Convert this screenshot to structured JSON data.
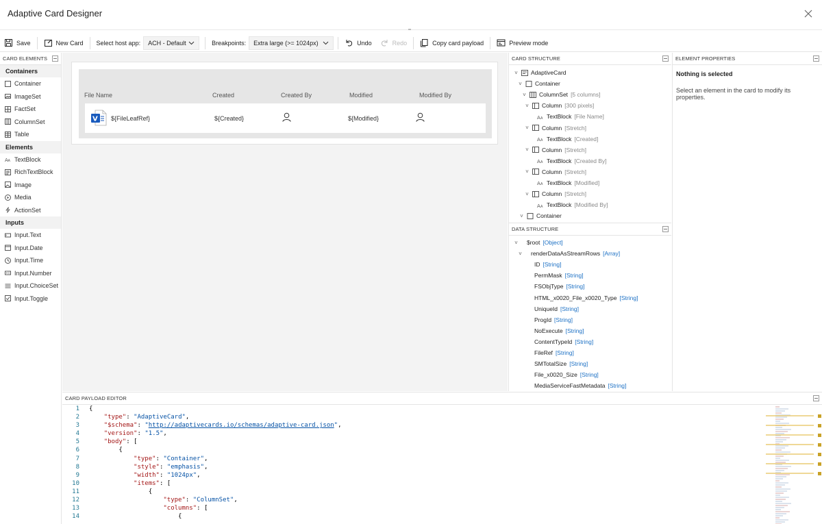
{
  "window": {
    "title": "Adaptive Card Designer"
  },
  "toolbar": {
    "save": "Save",
    "new_card": "New Card",
    "host_label": "Select host app:",
    "host_value": "ACH - Default",
    "bp_label": "Breakpoints:",
    "bp_value": "Extra large (>= 1024px)",
    "undo": "Undo",
    "redo": "Redo",
    "copy": "Copy card payload",
    "preview": "Preview mode"
  },
  "left": {
    "header": "CARD ELEMENTS",
    "containers_label": "Containers",
    "containers": [
      "Container",
      "ImageSet",
      "FactSet",
      "ColumnSet",
      "Table"
    ],
    "elements_label": "Elements",
    "elements": [
      "TextBlock",
      "RichTextBlock",
      "Image",
      "Media",
      "ActionSet"
    ],
    "inputs_label": "Inputs",
    "inputs": [
      "Input.Text",
      "Input.Date",
      "Input.Time",
      "Input.Number",
      "Input.ChoiceSet",
      "Input.Toggle"
    ]
  },
  "card": {
    "headers": [
      "File Name",
      "Created",
      "Created By",
      "Modified",
      "Modified By"
    ],
    "cells": {
      "file": "${FileLeafRef}",
      "created": "${Created}",
      "modified": "${Modified}"
    }
  },
  "structure": {
    "header": "CARD STRUCTURE",
    "rows": [
      {
        "label": "AdaptiveCard",
        "sub": ""
      },
      {
        "label": "Container",
        "sub": ""
      },
      {
        "label": "ColumnSet",
        "sub": "[5 columns]"
      },
      {
        "label": "Column",
        "sub": "[300 pixels]"
      },
      {
        "label": "TextBlock",
        "sub": "[File Name]"
      },
      {
        "label": "Column",
        "sub": "[Stretch]"
      },
      {
        "label": "TextBlock",
        "sub": "[Created]"
      },
      {
        "label": "Column",
        "sub": "[Stretch]"
      },
      {
        "label": "TextBlock",
        "sub": "[Created By]"
      },
      {
        "label": "Column",
        "sub": "[Stretch]"
      },
      {
        "label": "TextBlock",
        "sub": "[Modified]"
      },
      {
        "label": "Column",
        "sub": "[Stretch]"
      },
      {
        "label": "TextBlock",
        "sub": "[Modified By]"
      },
      {
        "label": "Container",
        "sub": ""
      }
    ]
  },
  "data_structure": {
    "header": "DATA STRUCTURE",
    "rows": [
      {
        "label": "$root",
        "type": "[Object]"
      },
      {
        "label": "renderDataAsStreamRows",
        "type": "[Array]"
      },
      {
        "label": "ID",
        "type": "[String]"
      },
      {
        "label": "PermMask",
        "type": "[String]"
      },
      {
        "label": "FSObjType",
        "type": "[String]"
      },
      {
        "label": "HTML_x0020_File_x0020_Type",
        "type": "[String]"
      },
      {
        "label": "UniqueId",
        "type": "[String]"
      },
      {
        "label": "ProgId",
        "type": "[String]"
      },
      {
        "label": "NoExecute",
        "type": "[String]"
      },
      {
        "label": "ContentTypeId",
        "type": "[String]"
      },
      {
        "label": "FileRef",
        "type": "[String]"
      },
      {
        "label": "SMTotalSize",
        "type": "[String]"
      },
      {
        "label": "File_x0020_Size",
        "type": "[String]"
      },
      {
        "label": "MediaServiceFastMetadata",
        "type": "[String]"
      }
    ]
  },
  "properties": {
    "header": "ELEMENT PROPERTIES",
    "none": "Nothing is selected",
    "desc": "Select an element in the card to modify its properties."
  },
  "editor": {
    "header": "CARD PAYLOAD EDITOR",
    "lines": [
      {
        "n": "1",
        "parts": [
          {
            "t": "{",
            "c": "pun"
          }
        ]
      },
      {
        "n": "2",
        "parts": [
          {
            "t": "    "
          },
          {
            "t": "\"type\"",
            "c": "key"
          },
          {
            "t": ": ",
            "c": "pun"
          },
          {
            "t": "\"AdaptiveCard\"",
            "c": "str"
          },
          {
            "t": ",",
            "c": "pun"
          }
        ]
      },
      {
        "n": "3",
        "parts": [
          {
            "t": "    "
          },
          {
            "t": "\"$schema\"",
            "c": "key"
          },
          {
            "t": ": ",
            "c": "pun"
          },
          {
            "t": "\"",
            "c": "str"
          },
          {
            "t": "http://adaptivecards.io/schemas/adaptive-card.json",
            "c": "url"
          },
          {
            "t": "\"",
            "c": "str"
          },
          {
            "t": ",",
            "c": "pun"
          }
        ]
      },
      {
        "n": "4",
        "parts": [
          {
            "t": "    "
          },
          {
            "t": "\"version\"",
            "c": "key"
          },
          {
            "t": ": ",
            "c": "pun"
          },
          {
            "t": "\"1.5\"",
            "c": "str"
          },
          {
            "t": ",",
            "c": "pun"
          }
        ]
      },
      {
        "n": "5",
        "parts": [
          {
            "t": "    "
          },
          {
            "t": "\"body\"",
            "c": "key"
          },
          {
            "t": ": [",
            "c": "pun"
          }
        ]
      },
      {
        "n": "6",
        "parts": [
          {
            "t": "        "
          },
          {
            "t": "{",
            "c": "pun"
          }
        ]
      },
      {
        "n": "7",
        "parts": [
          {
            "t": "            "
          },
          {
            "t": "\"type\"",
            "c": "key"
          },
          {
            "t": ": ",
            "c": "pun"
          },
          {
            "t": "\"Container\"",
            "c": "str"
          },
          {
            "t": ",",
            "c": "pun"
          }
        ]
      },
      {
        "n": "8",
        "parts": [
          {
            "t": "            "
          },
          {
            "t": "\"style\"",
            "c": "key"
          },
          {
            "t": ": ",
            "c": "pun"
          },
          {
            "t": "\"emphasis\"",
            "c": "str"
          },
          {
            "t": ",",
            "c": "pun"
          }
        ]
      },
      {
        "n": "9",
        "parts": [
          {
            "t": "            "
          },
          {
            "t": "\"width\"",
            "c": "key"
          },
          {
            "t": ": ",
            "c": "pun"
          },
          {
            "t": "\"1024px\"",
            "c": "str"
          },
          {
            "t": ",",
            "c": "pun"
          }
        ]
      },
      {
        "n": "10",
        "parts": [
          {
            "t": "            "
          },
          {
            "t": "\"items\"",
            "c": "key"
          },
          {
            "t": ": [",
            "c": "pun"
          }
        ]
      },
      {
        "n": "11",
        "parts": [
          {
            "t": "                "
          },
          {
            "t": "{",
            "c": "pun"
          }
        ]
      },
      {
        "n": "12",
        "parts": [
          {
            "t": "                    "
          },
          {
            "t": "\"type\"",
            "c": "key"
          },
          {
            "t": ": ",
            "c": "pun"
          },
          {
            "t": "\"ColumnSet\"",
            "c": "str"
          },
          {
            "t": ",",
            "c": "pun"
          }
        ]
      },
      {
        "n": "13",
        "parts": [
          {
            "t": "                    "
          },
          {
            "t": "\"columns\"",
            "c": "key"
          },
          {
            "t": ": [",
            "c": "pun"
          }
        ]
      },
      {
        "n": "14",
        "parts": [
          {
            "t": "                        "
          },
          {
            "t": "{",
            "c": "pun"
          }
        ]
      }
    ]
  },
  "colors": {
    "accent": "#1a6fc4",
    "word_blue": "#185abd",
    "json_key": "#a31515",
    "json_str": "#0451a5"
  }
}
